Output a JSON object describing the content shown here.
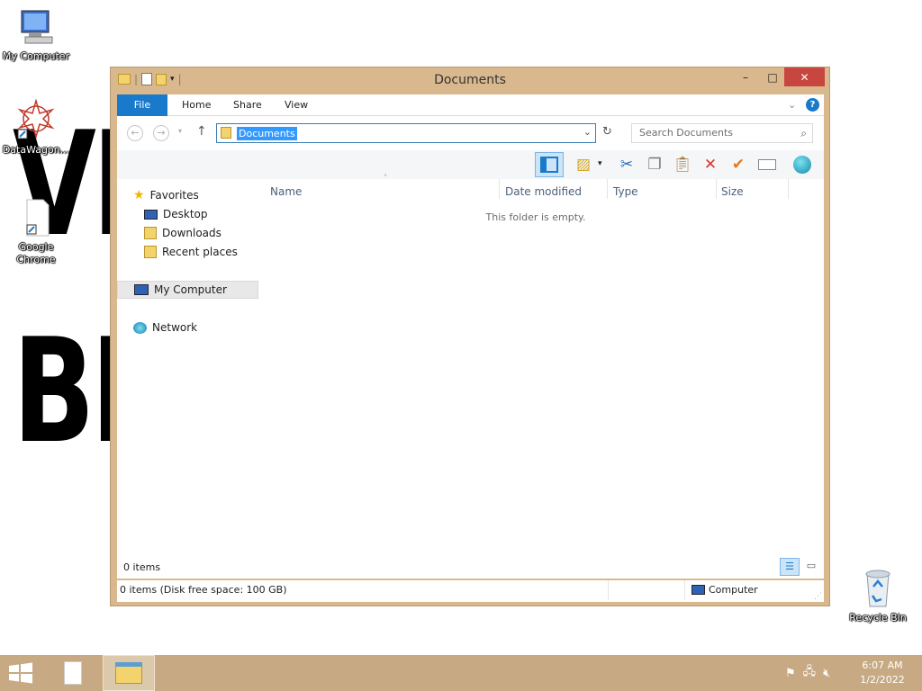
{
  "desktop": {
    "icons": [
      {
        "label": "My Computer",
        "icon": "computer-icon"
      },
      {
        "label": "DataWagon...",
        "icon": "datawagon-icon"
      },
      {
        "label": "Google Chrome",
        "icon": "chrome-shortcut-icon"
      },
      {
        "label": "Recycle Bin",
        "icon": "recycle-bin-icon"
      }
    ]
  },
  "window": {
    "title": "Documents",
    "controls": {
      "minimize": "–",
      "maximize": "□",
      "close": "✕"
    }
  },
  "ribbon": {
    "tabs": [
      "File",
      "Home",
      "Share",
      "View"
    ]
  },
  "address": {
    "path": "Documents",
    "search_placeholder": "Search Documents"
  },
  "nav_pane": {
    "favorites_label": "Favorites",
    "favorites": [
      "Desktop",
      "Downloads",
      "Recent places"
    ],
    "computer_label": "My Computer",
    "network_label": "Network"
  },
  "file_list": {
    "columns": [
      "Name",
      "Date modified",
      "Type",
      "Size"
    ],
    "empty_message": "This folder is empty.",
    "item_count": "0 items"
  },
  "status_bar": {
    "left_text": "0 items (Disk free space: 100 GB)",
    "right_text": "Computer"
  },
  "taskbar": {
    "time": "6:07 AM",
    "date": "1/2/2022"
  },
  "colors": {
    "window_frame": "#dab88e",
    "file_tab": "#1979ca",
    "taskbar": "#c7aa84",
    "close_button": "#c7463f",
    "selection": "#3399ff"
  }
}
